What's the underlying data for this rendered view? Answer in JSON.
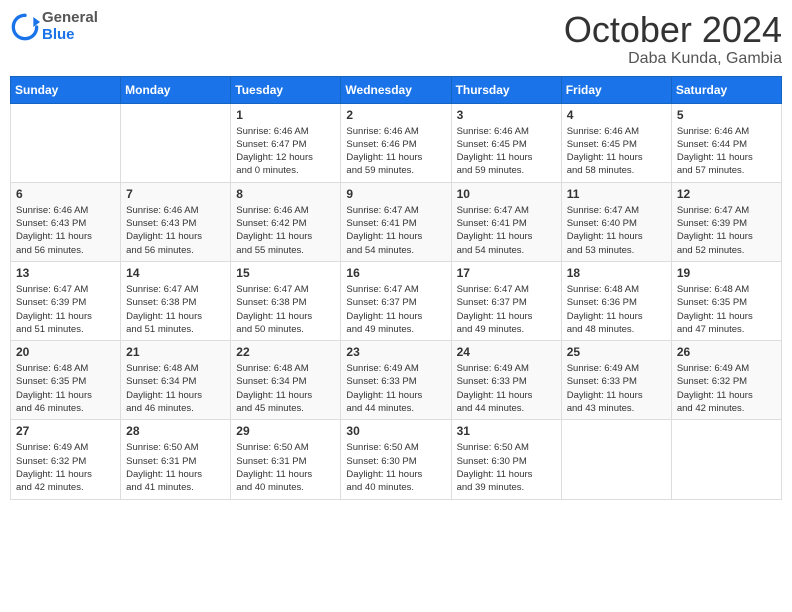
{
  "header": {
    "logo": {
      "general": "General",
      "blue": "Blue",
      "icon": "▶"
    },
    "title": "October 2024",
    "location": "Daba Kunda, Gambia"
  },
  "weekdays": [
    "Sunday",
    "Monday",
    "Tuesday",
    "Wednesday",
    "Thursday",
    "Friday",
    "Saturday"
  ],
  "weeks": [
    [
      {
        "day": "",
        "info": ""
      },
      {
        "day": "",
        "info": ""
      },
      {
        "day": "1",
        "info": "Sunrise: 6:46 AM\nSunset: 6:47 PM\nDaylight: 12 hours\nand 0 minutes."
      },
      {
        "day": "2",
        "info": "Sunrise: 6:46 AM\nSunset: 6:46 PM\nDaylight: 11 hours\nand 59 minutes."
      },
      {
        "day": "3",
        "info": "Sunrise: 6:46 AM\nSunset: 6:45 PM\nDaylight: 11 hours\nand 59 minutes."
      },
      {
        "day": "4",
        "info": "Sunrise: 6:46 AM\nSunset: 6:45 PM\nDaylight: 11 hours\nand 58 minutes."
      },
      {
        "day": "5",
        "info": "Sunrise: 6:46 AM\nSunset: 6:44 PM\nDaylight: 11 hours\nand 57 minutes."
      }
    ],
    [
      {
        "day": "6",
        "info": "Sunrise: 6:46 AM\nSunset: 6:43 PM\nDaylight: 11 hours\nand 56 minutes."
      },
      {
        "day": "7",
        "info": "Sunrise: 6:46 AM\nSunset: 6:43 PM\nDaylight: 11 hours\nand 56 minutes."
      },
      {
        "day": "8",
        "info": "Sunrise: 6:46 AM\nSunset: 6:42 PM\nDaylight: 11 hours\nand 55 minutes."
      },
      {
        "day": "9",
        "info": "Sunrise: 6:47 AM\nSunset: 6:41 PM\nDaylight: 11 hours\nand 54 minutes."
      },
      {
        "day": "10",
        "info": "Sunrise: 6:47 AM\nSunset: 6:41 PM\nDaylight: 11 hours\nand 54 minutes."
      },
      {
        "day": "11",
        "info": "Sunrise: 6:47 AM\nSunset: 6:40 PM\nDaylight: 11 hours\nand 53 minutes."
      },
      {
        "day": "12",
        "info": "Sunrise: 6:47 AM\nSunset: 6:39 PM\nDaylight: 11 hours\nand 52 minutes."
      }
    ],
    [
      {
        "day": "13",
        "info": "Sunrise: 6:47 AM\nSunset: 6:39 PM\nDaylight: 11 hours\nand 51 minutes."
      },
      {
        "day": "14",
        "info": "Sunrise: 6:47 AM\nSunset: 6:38 PM\nDaylight: 11 hours\nand 51 minutes."
      },
      {
        "day": "15",
        "info": "Sunrise: 6:47 AM\nSunset: 6:38 PM\nDaylight: 11 hours\nand 50 minutes."
      },
      {
        "day": "16",
        "info": "Sunrise: 6:47 AM\nSunset: 6:37 PM\nDaylight: 11 hours\nand 49 minutes."
      },
      {
        "day": "17",
        "info": "Sunrise: 6:47 AM\nSunset: 6:37 PM\nDaylight: 11 hours\nand 49 minutes."
      },
      {
        "day": "18",
        "info": "Sunrise: 6:48 AM\nSunset: 6:36 PM\nDaylight: 11 hours\nand 48 minutes."
      },
      {
        "day": "19",
        "info": "Sunrise: 6:48 AM\nSunset: 6:35 PM\nDaylight: 11 hours\nand 47 minutes."
      }
    ],
    [
      {
        "day": "20",
        "info": "Sunrise: 6:48 AM\nSunset: 6:35 PM\nDaylight: 11 hours\nand 46 minutes."
      },
      {
        "day": "21",
        "info": "Sunrise: 6:48 AM\nSunset: 6:34 PM\nDaylight: 11 hours\nand 46 minutes."
      },
      {
        "day": "22",
        "info": "Sunrise: 6:48 AM\nSunset: 6:34 PM\nDaylight: 11 hours\nand 45 minutes."
      },
      {
        "day": "23",
        "info": "Sunrise: 6:49 AM\nSunset: 6:33 PM\nDaylight: 11 hours\nand 44 minutes."
      },
      {
        "day": "24",
        "info": "Sunrise: 6:49 AM\nSunset: 6:33 PM\nDaylight: 11 hours\nand 44 minutes."
      },
      {
        "day": "25",
        "info": "Sunrise: 6:49 AM\nSunset: 6:33 PM\nDaylight: 11 hours\nand 43 minutes."
      },
      {
        "day": "26",
        "info": "Sunrise: 6:49 AM\nSunset: 6:32 PM\nDaylight: 11 hours\nand 42 minutes."
      }
    ],
    [
      {
        "day": "27",
        "info": "Sunrise: 6:49 AM\nSunset: 6:32 PM\nDaylight: 11 hours\nand 42 minutes."
      },
      {
        "day": "28",
        "info": "Sunrise: 6:50 AM\nSunset: 6:31 PM\nDaylight: 11 hours\nand 41 minutes."
      },
      {
        "day": "29",
        "info": "Sunrise: 6:50 AM\nSunset: 6:31 PM\nDaylight: 11 hours\nand 40 minutes."
      },
      {
        "day": "30",
        "info": "Sunrise: 6:50 AM\nSunset: 6:30 PM\nDaylight: 11 hours\nand 40 minutes."
      },
      {
        "day": "31",
        "info": "Sunrise: 6:50 AM\nSunset: 6:30 PM\nDaylight: 11 hours\nand 39 minutes."
      },
      {
        "day": "",
        "info": ""
      },
      {
        "day": "",
        "info": ""
      }
    ]
  ]
}
